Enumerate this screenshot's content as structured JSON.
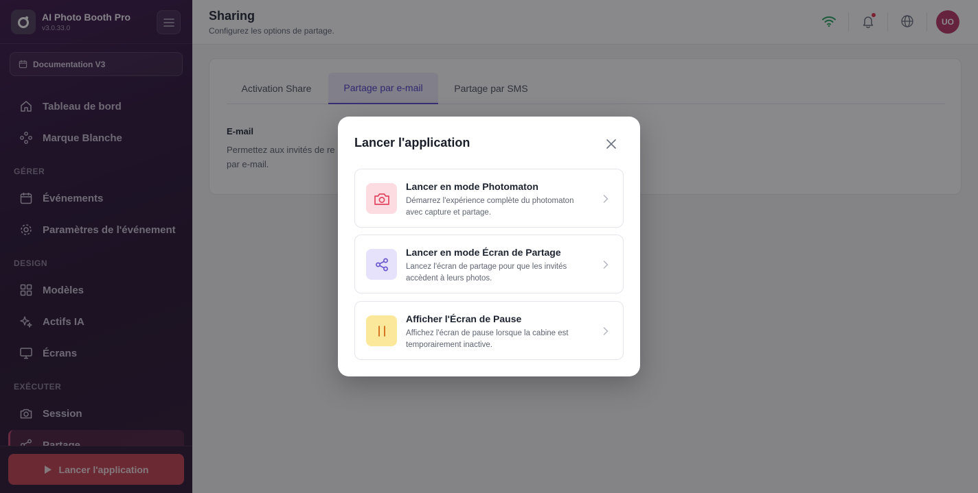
{
  "app": {
    "name": "AI Photo Booth Pro",
    "version": "v3.0.33.0"
  },
  "sidebar": {
    "project": "Documentation V3",
    "nav": {
      "dashboard": "Tableau de bord",
      "white_label": "Marque Blanche",
      "section_manage": "GÉRER",
      "events": "Événements",
      "event_settings": "Paramètres de l'événement",
      "section_design": "DESIGN",
      "templates": "Modèles",
      "ai_assets": "Actifs IA",
      "screens": "Écrans",
      "section_run": "EXÉCUTER",
      "session": "Session",
      "sharing": "Partage"
    },
    "launch_label": "Lancer l'application"
  },
  "header": {
    "title": "Sharing",
    "subtitle": "Configurez les options de partage.",
    "avatar_initials": "UO"
  },
  "content": {
    "tabs": [
      "Activation Share",
      "Partage par e-mail",
      "Partage par SMS"
    ],
    "active_tab": "Partage par e-mail",
    "section_title": "E-mail",
    "section_desc": "Permettez aux invités de re par e-mail."
  },
  "modal": {
    "title": "Lancer l'application",
    "options": [
      {
        "title": "Lancer en mode Photomaton",
        "desc": "Démarrez l'expérience complète du photomaton avec capture et partage.",
        "icon": "camera-icon"
      },
      {
        "title": "Lancer en mode Écran de Partage",
        "desc": "Lancez l'écran de partage pour que les invités accèdent à leurs photos.",
        "icon": "share-icon"
      },
      {
        "title": "Afficher l'Écran de Pause",
        "desc": "Affichez l'écran de pause lorsque la cabine est temporairement inactive.",
        "icon": "pause-icon"
      }
    ]
  },
  "colors": {
    "accent": "#5a48d0",
    "brand": "#c2404f",
    "avatar": "#b83262",
    "wifi": "#22a35a",
    "notification": "#e0304a"
  }
}
